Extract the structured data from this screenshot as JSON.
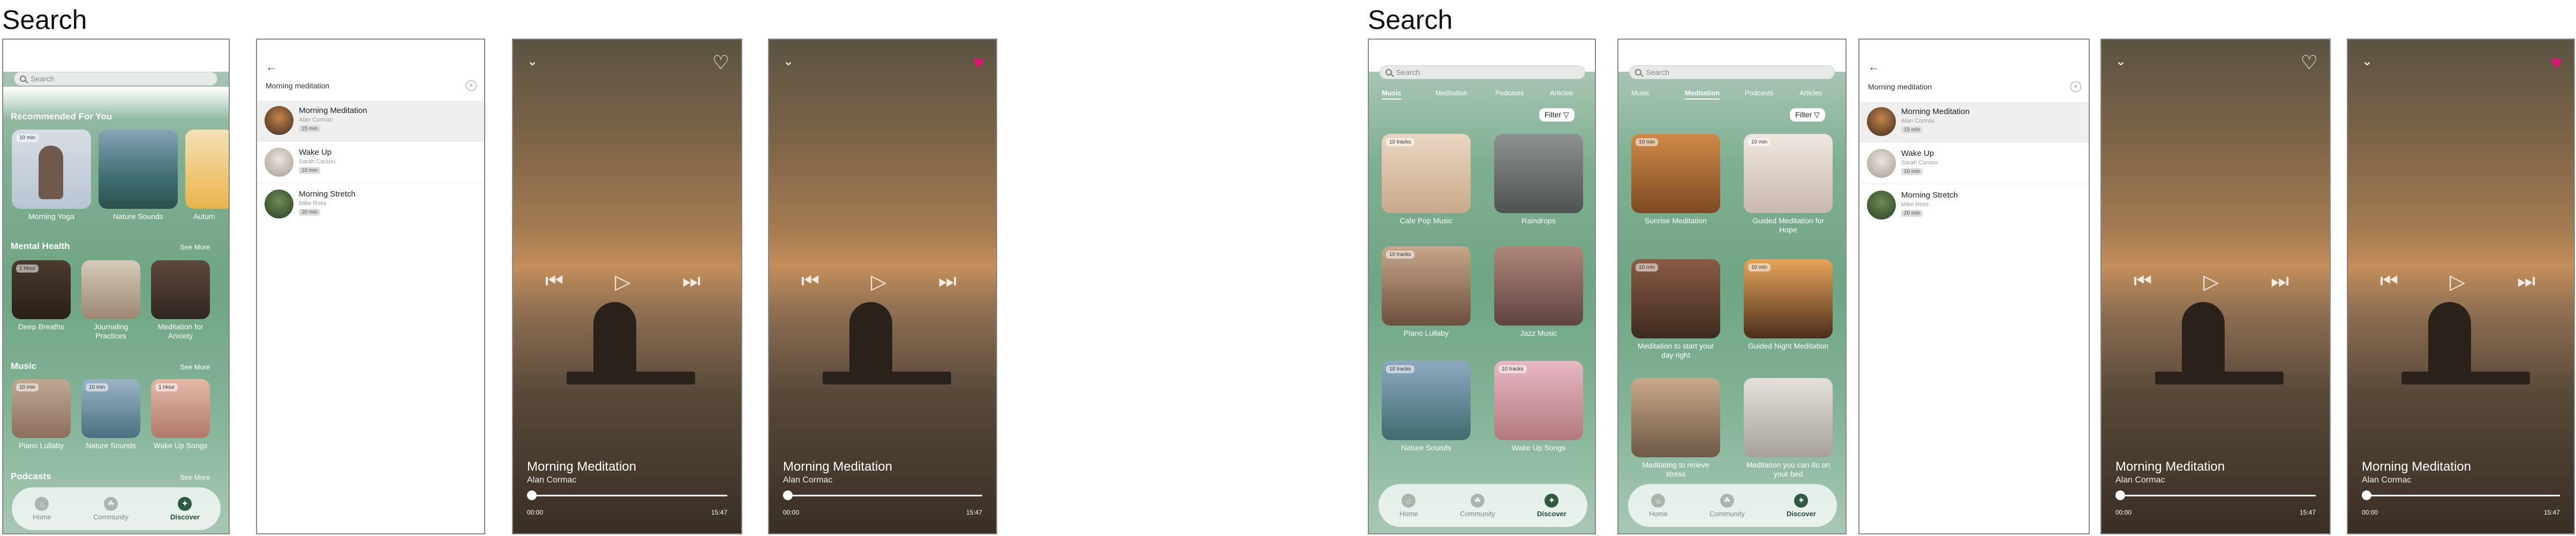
{
  "sections": [
    {
      "title": "Search"
    },
    {
      "title": "Search"
    }
  ],
  "home": {
    "search_placeholder": "Search",
    "recommended_title": "Recommended For You",
    "recommended": [
      {
        "tag": "10 min",
        "label": "Morning Yoga"
      },
      {
        "tag": "",
        "label": "Nature Sounds"
      },
      {
        "tag": "",
        "label": "Autum"
      }
    ],
    "mental_title": "Mental Health",
    "mental_see_more": "See More",
    "mental": [
      {
        "tag": "1 Hour",
        "label": "Deep Breaths"
      },
      {
        "tag": "",
        "label": "Journaling Practices"
      },
      {
        "tag": "",
        "label": "Meditation for Anxiety"
      }
    ],
    "music_title": "Music",
    "music_see_more": "See More",
    "music": [
      {
        "tag": "10 min",
        "label": "Piano Lullaby"
      },
      {
        "tag": "10 min",
        "label": "Nature Sounds"
      },
      {
        "tag": "1 Hour",
        "label": "Wake Up Songs"
      }
    ],
    "podcasts_title": "Podcasts",
    "podcasts_see_more": "See More"
  },
  "nav": {
    "home": "Home",
    "community": "Community",
    "discover": "Discover"
  },
  "results": {
    "query": "Morning meditation",
    "items": [
      {
        "title": "Morning Meditation",
        "sub": "Alan Cormac",
        "badge": "15 min"
      },
      {
        "title": "Wake Up",
        "sub": "Sarah Carson",
        "badge": "10 min"
      },
      {
        "title": "Morning Stretch",
        "sub": "Mike Ross",
        "badge": "20 min"
      }
    ]
  },
  "player": {
    "title": "Morning Meditation",
    "artist": "Alan Cormac",
    "time_start": "00:00",
    "time_end": "15:47",
    "progress": 0
  },
  "tabs": {
    "music": "Music",
    "meditation": "Meditation",
    "podcasts": "Podcasts",
    "articles": "Articles",
    "filter": "Filter"
  },
  "music_grid": [
    {
      "tag": "10 tracks",
      "label": "Cafe Pop Music"
    },
    {
      "tag": "",
      "label": "Raindrops"
    },
    {
      "tag": "10 tracks",
      "label": "Piano Lullaby"
    },
    {
      "tag": "",
      "label": "Jazz Music"
    },
    {
      "tag": "10 tracks",
      "label": "Nature Sounds"
    },
    {
      "tag": "10 tracks",
      "label": "Wake Up Songs"
    }
  ],
  "meditation_grid": [
    {
      "tag": "10 min",
      "label": "Sunrise Meditation"
    },
    {
      "tag": "10 min",
      "label": "Guided Meditation for Hope"
    },
    {
      "tag": "10 min",
      "label": "Meditation to start your day right"
    },
    {
      "tag": "10 min",
      "label": "Guided Night Meditation"
    },
    {
      "tag": "",
      "label": "Meditating to relieve stress"
    },
    {
      "tag": "",
      "label": "Meditation you can do on your bed"
    }
  ],
  "colors": {
    "accent": "#2c5b42",
    "heart_active": "#e0147a"
  }
}
